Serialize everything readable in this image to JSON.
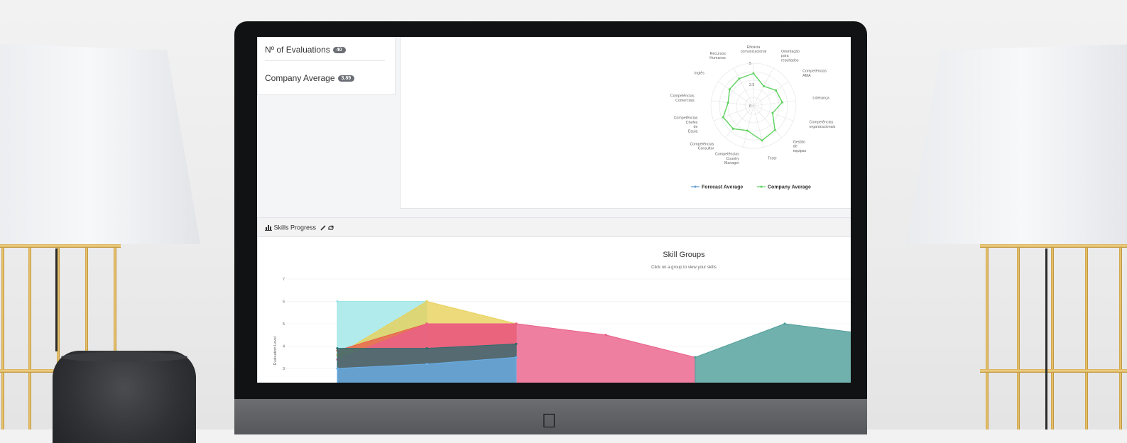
{
  "stats": {
    "evaluations_label": "Nº of Evaluations",
    "evaluations_count": "40",
    "average_label": "Company Average",
    "average_value": "3.89"
  },
  "radar": {
    "axes": [
      "Eficácia comunicacional",
      "Orientação para resultados",
      "Competências AMA",
      "Liderança",
      "Competências organizacionais",
      "Gestão de equipas",
      "Teste",
      "Competências Country Manager",
      "Competências Consultor",
      "Competências Chefes de Equia",
      "Competências Comerciais",
      "Inglês",
      "Recursos Humanos"
    ],
    "ticks": [
      "5",
      "2.5",
      "0"
    ],
    "legend": [
      "Forecast Average",
      "Company Average"
    ],
    "colors": {
      "forecast": "#5b9bd5",
      "company": "#5fd35f"
    }
  },
  "progress": {
    "title": "Skills Progress",
    "chart_title": "Skill Groups",
    "subtitle": "Click on a group to view your skills",
    "ylabel": "Evaluation Level",
    "yticks": [
      "7",
      "6",
      "5",
      "4",
      "3"
    ]
  },
  "chart_data": [
    {
      "type": "radar",
      "categories": [
        "Eficácia comunicacional",
        "Orientação para resultados",
        "Competências AMA",
        "Liderança",
        "Competências organizacionais",
        "Gestão de equipas",
        "Teste",
        "Competências Country Manager",
        "Competências Consultor",
        "Competências Chefes de Equia",
        "Competências Comerciais",
        "Inglês",
        "Recursos Humanos"
      ],
      "series": [
        {
          "name": "Company Average",
          "values": [
            3.8,
            2.6,
            3.2,
            3.4,
            2.4,
            3.8,
            4.2,
            3.0,
            3.6,
            3.8,
            3.0,
            3.4,
            3.6
          ]
        }
      ],
      "ylim": [
        0,
        5
      ],
      "legend_position": "bottom"
    },
    {
      "type": "area",
      "title": "Skill Groups",
      "ylabel": "Evaluation Level",
      "ylim": [
        3,
        7
      ],
      "x": [
        0,
        1,
        2,
        3,
        4,
        5,
        6
      ],
      "series": [
        {
          "values": [
            6.0,
            6.0,
            null,
            null,
            null,
            null,
            null
          ],
          "color": "#9ee6e6"
        },
        {
          "values": [
            3.6,
            6.0,
            5.0,
            null,
            null,
            null,
            null
          ],
          "color": "#e8d15a"
        },
        {
          "values": [
            3.8,
            5.0,
            5.0,
            null,
            null,
            null,
            null
          ],
          "color": "#e8604c"
        },
        {
          "values": [
            3.4,
            5.0,
            5.0,
            4.5,
            3.5,
            null,
            null
          ],
          "color": "#ea5f88"
        },
        {
          "values": [
            null,
            null,
            null,
            null,
            3.5,
            5.0,
            4.5
          ],
          "color": "#4d9e99"
        },
        {
          "values": [
            3.9,
            3.9,
            4.1,
            null,
            null,
            null,
            null
          ],
          "color": "#2f6c6e"
        },
        {
          "values": [
            3.0,
            3.2,
            3.5,
            null,
            null,
            null,
            null
          ],
          "color": "#6aaee6"
        }
      ]
    }
  ]
}
